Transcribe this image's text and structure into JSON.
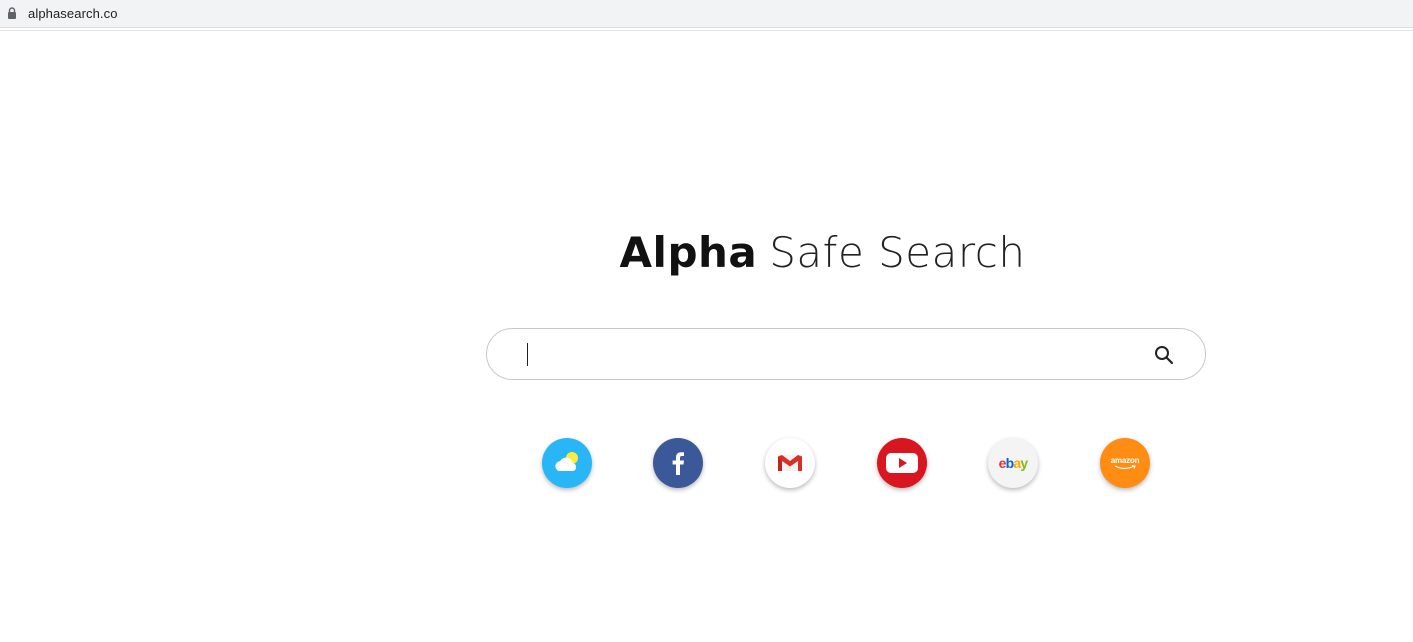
{
  "browser": {
    "url": "alphasearch.co"
  },
  "logo": {
    "bold": "Alpha",
    "light": "Safe Search"
  },
  "search": {
    "value": "",
    "placeholder": ""
  },
  "shortcuts": [
    {
      "name": "weather",
      "color": "#29b6f6"
    },
    {
      "name": "facebook",
      "color": "#3b5998"
    },
    {
      "name": "gmail",
      "color": "#ffffff"
    },
    {
      "name": "youtube",
      "color": "#d9161f"
    },
    {
      "name": "ebay",
      "color": "#f4f4f4",
      "logo_letters": [
        "e",
        "b",
        "a",
        "y"
      ],
      "logo_colors": [
        "#e53238",
        "#0064d2",
        "#f5af02",
        "#86b817"
      ]
    },
    {
      "name": "amazon",
      "color": "#ff8c13",
      "logo_text": "amazon"
    }
  ],
  "colors": {
    "addressbar_bg": "#f1f3f4",
    "search_border": "#c8c8c8"
  }
}
